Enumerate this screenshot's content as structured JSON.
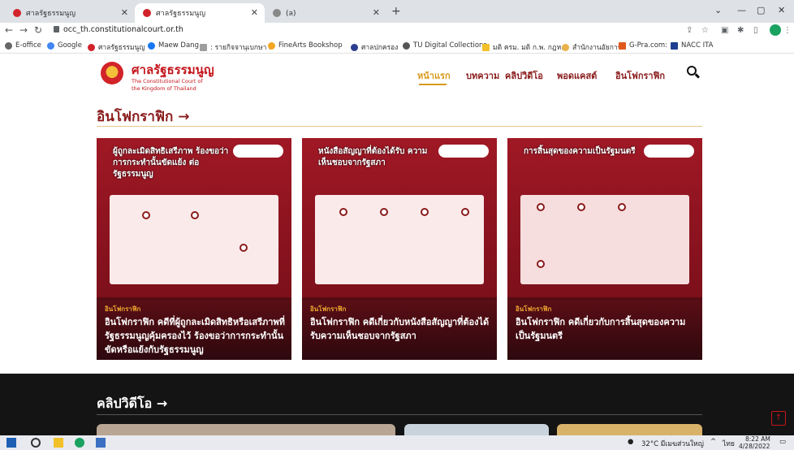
{
  "browser": {
    "tabs": [
      {
        "label": "ศาลรัฐธรรมนูญ",
        "active": false
      },
      {
        "label": "ศาลรัฐธรรมนูญ",
        "active": true
      },
      {
        "label": "(ล)",
        "active": false
      }
    ],
    "url": "occ_th.constitutionalcourt.or.th",
    "bookmarks": [
      "E-office",
      "Google",
      "ศาลรัฐธรรมนูญ",
      "Maew Dang",
      ": รายกิจจานุเบกษา :",
      "FineArts Bookshop",
      "ศาลปกครอง",
      "TU Digital Collections",
      "มติ ครม. มติ ก.พ. กฎห...",
      "สำนักงานอัยการ",
      "G-Pra.com:",
      "NACC ITA"
    ]
  },
  "site": {
    "logo_th": "ศาลรัฐธรรมนูญ",
    "logo_en_1": "The Constitutional Court of",
    "logo_en_2": "the Kingdom of Thailand",
    "nav": [
      "หน้าแรก",
      "บทความ",
      "คลิปวิดีโอ",
      "พอดแคสต์",
      "อินโฟกราฟิก"
    ]
  },
  "infographic": {
    "section_title": "อินโฟกราฟิก →",
    "cards": [
      {
        "art_heading": "ผู้ถูกละเมิดสิทธิเสรีภาพ ร้องขอว่า การกระทำนั้นขัดแย้ง ต่อรัฐธรรมนูญ",
        "category": "อินโฟกราฟิก",
        "title": "อินโฟกราฟิก คดีที่ผู้ถูกละเมิดสิทธิหรือเสรีภาพที่รัฐธรรมนูญคุ้มครองไว้ ร้องขอว่าการกระทำนั้นขัดหรือแย้งกับรัฐธรรมนูญ"
      },
      {
        "art_heading": "หนังสือสัญญาที่ต้องได้รับ ความเห็นชอบจากรัฐสภา",
        "category": "อินโฟกราฟิก",
        "title": "อินโฟกราฟิก คดีเกี่ยวกับหนังสือสัญญาที่ต้องได้รับความเห็นชอบจากรัฐสภา"
      },
      {
        "art_heading": "การสิ้นสุดของความเป็นรัฐมนตรี",
        "category": "อินโฟกราฟิก",
        "title": "อินโฟกราฟิก คดีเกี่ยวกับการสิ้นสุดของความเป็นรัฐมนตรี"
      }
    ]
  },
  "clips": {
    "section_title": "คลิปวิดีโอ →"
  },
  "taskbar": {
    "weather": "32°C มีเมฆส่วนใหญ่",
    "lang": "ไทย",
    "time": "8:22 AM",
    "date": "4/28/2022"
  },
  "colors": {
    "brand_red": "#c4161c",
    "nav_maroon": "#8a1c1c",
    "gold": "#d89a1c",
    "card_bg": "#8d1420"
  }
}
